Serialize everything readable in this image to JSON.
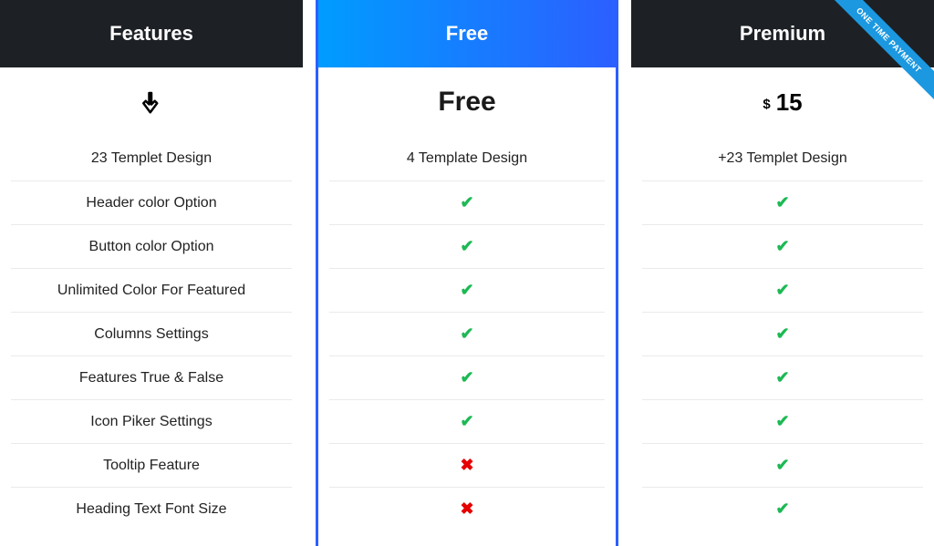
{
  "headers": {
    "features": "Features",
    "free": "Free",
    "premium": "Premium"
  },
  "prices": {
    "free": "Free",
    "premium_currency": "$",
    "premium_value": "15"
  },
  "ribbon": "ONE TIME PAYMENT",
  "features": [
    "23 Templet Design",
    "Header color Option",
    "Button color Option",
    "Unlimited Color For Featured",
    "Columns Settings",
    "Features True & False",
    "Icon Piker Settings",
    "Tooltip Feature",
    "Heading Text Font Size"
  ],
  "free_col": {
    "first": "4 Template Design",
    "values": [
      "check",
      "check",
      "check",
      "check",
      "check",
      "check",
      "cross",
      "cross"
    ]
  },
  "premium_col": {
    "first": "+23 Templet Design",
    "values": [
      "check",
      "check",
      "check",
      "check",
      "check",
      "check",
      "check",
      "check"
    ]
  }
}
